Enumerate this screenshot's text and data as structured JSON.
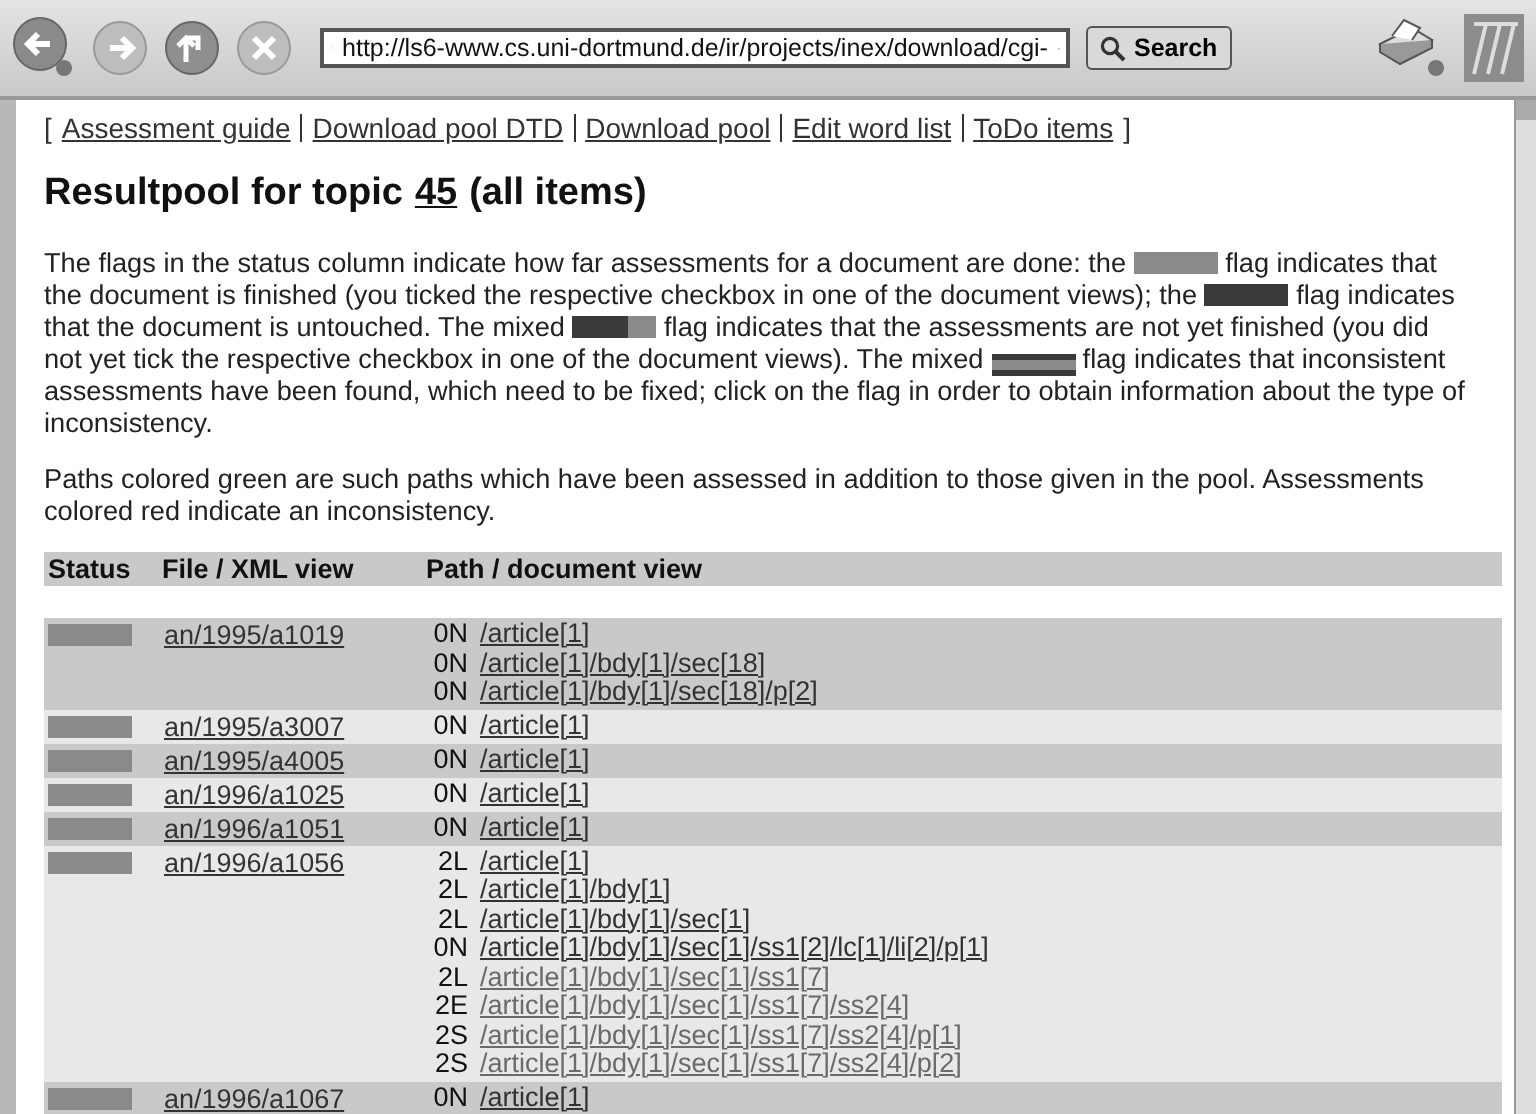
{
  "toolbar": {
    "url": "http://ls6-www.cs.uni-dortmund.de/ir/projects/inex/download/cgi-",
    "search_button": "Search",
    "back_enabled": true,
    "forward_enabled": false,
    "stop_enabled": false
  },
  "nav_links": [
    {
      "label": "Assessment guide"
    },
    {
      "label": "Download pool DTD"
    },
    {
      "label": "Download pool"
    },
    {
      "label": "Edit word list"
    },
    {
      "label": "ToDo items"
    }
  ],
  "nav_brackets": [
    "[",
    "]"
  ],
  "title": {
    "prefix": "Resultpool for topic",
    "topic": "45",
    "suffix": "(all items)"
  },
  "intro": [
    {
      "kind": "text",
      "text": "The flags in the status column indicate how far assessments for a document are done: the"
    },
    {
      "kind": "finished"
    },
    {
      "kind": "text",
      "text": "flag indicates that the document is finished (you ticked the respective checkbox in one of the document views); the"
    },
    {
      "kind": "untouched"
    },
    {
      "kind": "text",
      "text": "flag indicates that the document is untouched. The mixed"
    },
    {
      "kind": "mixed"
    },
    {
      "kind": "text",
      "text": "flag indicates that the assessments are not yet finished (you did not yet tick the respective checkbox in one of the document views). The mixed"
    },
    {
      "kind": "inconsistent"
    },
    {
      "kind": "text",
      "text": "flag indicates that inconsistent assessments have been found, which need to be fixed; click on the flag in order to obtain information about the type of inconsistency."
    }
  ],
  "note": "Paths colored green are such paths which have been assessed in addition to those given in the pool. Assessments colored red indicate an inconsistency.",
  "table": {
    "columns": [
      "Status",
      "File / XML view",
      "Path / document view"
    ],
    "rows": [
      {
        "kind": "finished",
        "file": "an/1995/a1019",
        "paths": [
          {
            "code": "0N",
            "path": "/article[1]",
            "added": false
          },
          {
            "code": "0N",
            "path": "/article[1]/bdy[1]/sec[18]",
            "added": false
          },
          {
            "code": "0N",
            "path": "/article[1]/bdy[1]/sec[18]/p[2]",
            "added": false
          }
        ]
      },
      {
        "kind": "finished",
        "file": "an/1995/a3007",
        "paths": [
          {
            "code": "0N",
            "path": "/article[1]",
            "added": false
          }
        ]
      },
      {
        "kind": "finished",
        "file": "an/1995/a4005",
        "paths": [
          {
            "code": "0N",
            "path": "/article[1]",
            "added": false
          }
        ]
      },
      {
        "kind": "finished",
        "file": "an/1996/a1025",
        "paths": [
          {
            "code": "0N",
            "path": "/article[1]",
            "added": false
          }
        ]
      },
      {
        "kind": "finished",
        "file": "an/1996/a1051",
        "paths": [
          {
            "code": "0N",
            "path": "/article[1]",
            "added": false
          }
        ]
      },
      {
        "kind": "finished",
        "file": "an/1996/a1056",
        "paths": [
          {
            "code": "2L",
            "path": "/article[1]",
            "added": false
          },
          {
            "code": "2L",
            "path": "/article[1]/bdy[1]",
            "added": false
          },
          {
            "code": "2L",
            "path": "/article[1]/bdy[1]/sec[1]",
            "added": false
          },
          {
            "code": "0N",
            "path": "/article[1]/bdy[1]/sec[1]/ss1[2]/lc[1]/li[2]/p[1]",
            "added": false
          },
          {
            "code": "2L",
            "path": "/article[1]/bdy[1]/sec[1]/ss1[7]",
            "added": true
          },
          {
            "code": "2E",
            "path": "/article[1]/bdy[1]/sec[1]/ss1[7]/ss2[4]",
            "added": true
          },
          {
            "code": "2S",
            "path": "/article[1]/bdy[1]/sec[1]/ss1[7]/ss2[4]/p[1]",
            "added": true
          },
          {
            "code": "2S",
            "path": "/article[1]/bdy[1]/sec[1]/ss1[7]/ss2[4]/p[2]",
            "added": true
          }
        ]
      },
      {
        "kind": "finished",
        "file": "an/1996/a1067",
        "paths": [
          {
            "code": "0N",
            "path": "/article[1]",
            "added": false
          }
        ]
      }
    ]
  }
}
